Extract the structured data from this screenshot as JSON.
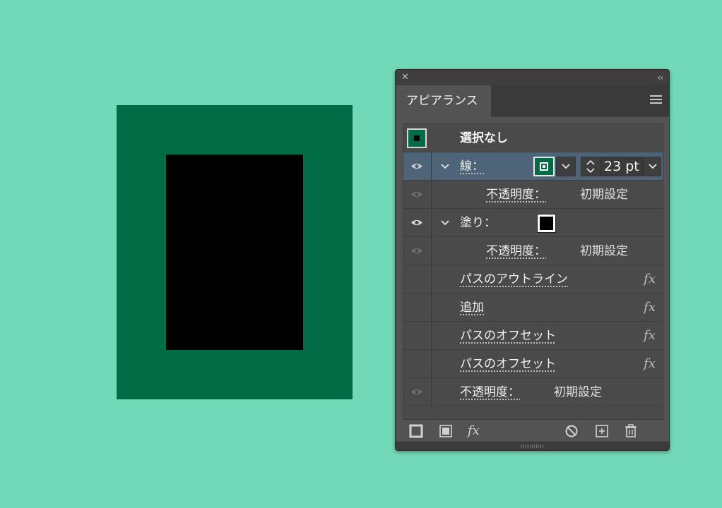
{
  "panel": {
    "tab_label": "アピアランス",
    "close_glyph": "✕",
    "collapse_glyph": "‹‹"
  },
  "rows": {
    "header": {
      "label": "選択なし"
    },
    "stroke": {
      "label": "線：",
      "weight": "23 pt"
    },
    "stroke_opacity": {
      "label": "不透明度：",
      "value": "初期設定"
    },
    "fill": {
      "label": "塗り："
    },
    "fill_opacity": {
      "label": "不透明度：",
      "value": "初期設定"
    },
    "effect1": {
      "label": "パスのアウトライン",
      "fx": "fx"
    },
    "effect2": {
      "label": "追加",
      "fx": "fx"
    },
    "effect3": {
      "label": "パスのオフセット",
      "fx": "fx"
    },
    "effect4": {
      "label": "パスのオフセット",
      "fx": "fx"
    },
    "opacity": {
      "label": "不透明度：",
      "value": "初期設定"
    }
  },
  "footer": {
    "fx_label": "fx"
  },
  "colors": {
    "background": "#72d9b8",
    "art_fill": "#006b45",
    "art_inner": "#000000",
    "selected_row": "#4e6479"
  },
  "icons": [
    "close-icon",
    "collapse-icon",
    "menu-icon",
    "eye-icon",
    "chevron-down-icon",
    "stroke-swatch-icon",
    "fill-swatch-icon",
    "stepper-icon",
    "new-stroke-icon",
    "new-fill-icon",
    "add-effect-icon",
    "clear-appearance-icon",
    "duplicate-icon",
    "trash-icon"
  ]
}
